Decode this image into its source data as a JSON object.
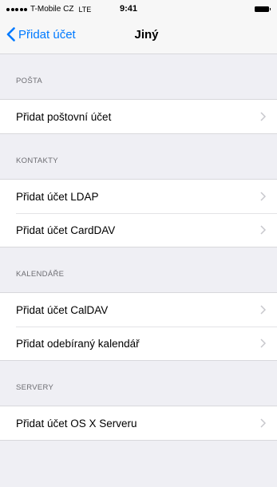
{
  "status_bar": {
    "carrier": "T-Mobile CZ",
    "network": "LTE",
    "time": "9:41"
  },
  "nav": {
    "back_label": "Přidat účet",
    "title": "Jiný"
  },
  "sections": [
    {
      "header": "POŠTA",
      "items": [
        "Přidat poštovní účet"
      ]
    },
    {
      "header": "KONTAKTY",
      "items": [
        "Přidat účet LDAP",
        "Přidat účet CardDAV"
      ]
    },
    {
      "header": "KALENDÁŘE",
      "items": [
        "Přidat účet CalDAV",
        "Přidat odebíraný kalendář"
      ]
    },
    {
      "header": "SERVERY",
      "items": [
        "Přidat účet OS X Serveru"
      ]
    }
  ],
  "colors": {
    "accent": "#007aff",
    "background": "#efeff4",
    "header_text": "#6d6d72",
    "chevron": "#c7c7cc"
  }
}
